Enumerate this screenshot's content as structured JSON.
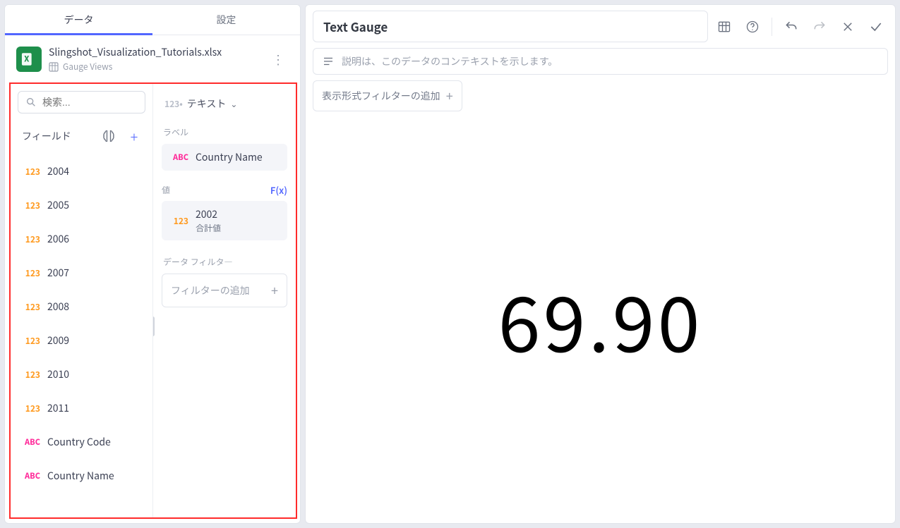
{
  "tabs": {
    "data": "データ",
    "settings": "設定"
  },
  "datasource": {
    "badge": "X",
    "title": "Slingshot_Visualization_Tutorials.xlsx",
    "subtitle": "Gauge Views"
  },
  "search": {
    "placeholder": "検索..."
  },
  "fields_header": {
    "label": "フィールド"
  },
  "fields": [
    {
      "type": "num",
      "name": "2004"
    },
    {
      "type": "num",
      "name": "2005"
    },
    {
      "type": "num",
      "name": "2006"
    },
    {
      "type": "num",
      "name": "2007"
    },
    {
      "type": "num",
      "name": "2008"
    },
    {
      "type": "num",
      "name": "2009"
    },
    {
      "type": "num",
      "name": "2010"
    },
    {
      "type": "num",
      "name": "2011"
    },
    {
      "type": "abc",
      "name": "Country Code"
    },
    {
      "type": "abc",
      "name": "Country Name"
    }
  ],
  "viz_selector": {
    "prefix": "123•",
    "label": "テキスト"
  },
  "shelves": {
    "label_section": "ラベル",
    "label_pill": {
      "type": "abc",
      "text": "Country Name"
    },
    "value_section": "値",
    "fx_button": "F(x)",
    "value_pill": {
      "type": "num",
      "text": "2002",
      "sub": "合計値"
    },
    "filter_section": "データ フィルタ―",
    "filter_add": "フィルターの追加"
  },
  "right": {
    "title": "Text Gauge",
    "description_placeholder": "説明は、このデータのコンテキストを示します。",
    "viz_filter_add": "表示形式フィルターの追加",
    "big_value": "69.90"
  },
  "badges": {
    "num": "123",
    "abc": "ABC"
  },
  "chart_data": {
    "type": "table",
    "title": "Text Gauge",
    "label_field": "Country Name",
    "value_field": "2002",
    "aggregation": "合計値",
    "display_value": 69.9
  }
}
